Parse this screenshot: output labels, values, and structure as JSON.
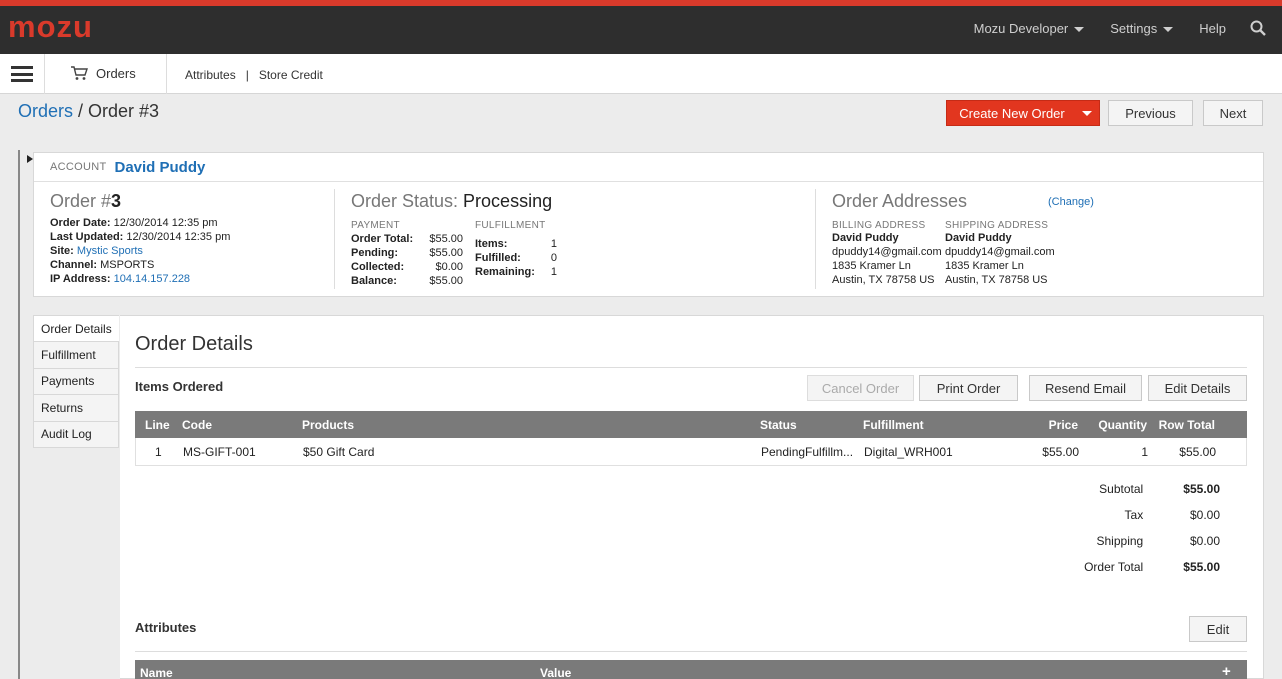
{
  "app": {
    "logo": "mozu",
    "colors": {
      "brand_red": "#d93a2b",
      "link_blue": "#1f6fb5",
      "header_dark": "#2e2e2e"
    }
  },
  "topnav": {
    "developer": "Mozu Developer",
    "settings": "Settings",
    "help": "Help",
    "search_icon": "search-icon"
  },
  "secbar": {
    "orders": "Orders",
    "attributes": "Attributes",
    "pipe": "|",
    "store_credit": "Store Credit"
  },
  "breadcrumb": {
    "root": "Orders",
    "sep": " / ",
    "current": "Order #3"
  },
  "actions": {
    "create": "Create New Order",
    "previous": "Previous",
    "next": "Next"
  },
  "summary": {
    "account_label": "ACCOUNT",
    "account_name": "David Puddy",
    "order": {
      "prefix": "Order #",
      "number": "3",
      "fields": [
        {
          "label": "Order Date:",
          "value": " 12/30/2014 12:35 pm"
        },
        {
          "label": "Last Updated:",
          "value": " 12/30/2014 12:35 pm"
        },
        {
          "label": "Site:",
          "value": " Mystic Sports"
        },
        {
          "label": "Channel:",
          "value": " MSPORTS"
        },
        {
          "label": "IP Address:",
          "value": " 104.14.157.228"
        }
      ]
    },
    "status": {
      "prefix": "Order Status: ",
      "value": "Processing",
      "payment_label": "PAYMENT",
      "payment": [
        {
          "label": "Order Total:",
          "value": "$55.00"
        },
        {
          "label": "Pending:",
          "value": "$55.00"
        },
        {
          "label": "Collected:",
          "value": "$0.00"
        },
        {
          "label": "Balance:",
          "value": "$55.00"
        }
      ],
      "fulfillment_label": "FULFILLMENT",
      "fulfillment": [
        {
          "label": "Items:",
          "value": "1"
        },
        {
          "label": "Fulfilled:",
          "value": "0"
        },
        {
          "label": "Remaining:",
          "value": "1"
        }
      ]
    },
    "addresses": {
      "title": "Order Addresses",
      "change": "(Change)",
      "billing_label": "BILLING ADDRESS",
      "billing": {
        "name": "David Puddy",
        "email": "dpuddy14@gmail.com",
        "street": "1835 Kramer Ln",
        "city": "Austin, TX 78758 US"
      },
      "shipping_label": "SHIPPING ADDRESS",
      "shipping": {
        "name": "David Puddy",
        "email": "dpuddy14@gmail.com",
        "street": "1835 Kramer Ln",
        "city": "Austin, TX 78758 US"
      }
    }
  },
  "sidetabs": [
    "Order Details",
    "Fulfillment",
    "Payments",
    "Returns",
    "Audit Log"
  ],
  "details": {
    "title": "Order Details",
    "items_heading": "Items Ordered",
    "buttons": {
      "cancel": "Cancel Order",
      "print": "Print Order",
      "resend": "Resend Email",
      "edit": "Edit Details"
    },
    "columns": [
      "Line",
      "Code",
      "Products",
      "Status",
      "Fulfillment",
      "Price",
      "Quantity",
      "Row Total"
    ],
    "rows": [
      {
        "line": "1",
        "code": "MS-GIFT-001",
        "product": "$50 Gift Card",
        "status": "PendingFulfillm...",
        "fulfillment": "Digital_WRH001",
        "price": "$55.00",
        "quantity": "1",
        "row_total": "$55.00"
      }
    ],
    "totals": [
      {
        "label": "Subtotal",
        "value": "$55.00",
        "bold": true
      },
      {
        "label": "Tax",
        "value": "$0.00",
        "bold": false
      },
      {
        "label": "Shipping",
        "value": "$0.00",
        "bold": false
      },
      {
        "label": "Order Total",
        "value": "$55.00",
        "bold": true
      }
    ],
    "attributes_heading": "Attributes",
    "attributes_edit": "Edit",
    "attr_columns": {
      "name": "Name",
      "value": "Value",
      "add": "+"
    }
  }
}
